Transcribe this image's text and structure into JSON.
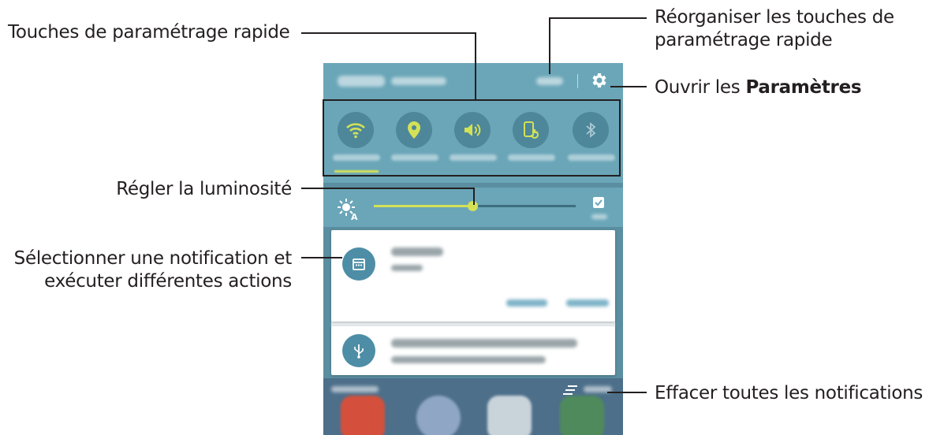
{
  "callouts": {
    "quick_settings": "Touches de paramétrage rapide",
    "rearrange_line1": "Réorganiser les touches de",
    "rearrange_line2": "paramétrage rapide",
    "open_settings_prefix": "Ouvrir les ",
    "open_settings_bold": "Paramètres",
    "brightness": "Régler la luminosité",
    "notification_line1": "Sélectionner une notification et",
    "notification_line2": "exécuter différentes actions",
    "clear_all": "Effacer toutes les notifications"
  },
  "quick_settings": {
    "buttons": [
      {
        "name": "wifi",
        "icon": "wifi-icon",
        "active": true
      },
      {
        "name": "location",
        "icon": "location-pin-icon",
        "active": true
      },
      {
        "name": "sound",
        "icon": "speaker-icon",
        "active": true
      },
      {
        "name": "screen-rotation",
        "icon": "rotation-icon",
        "active": true
      },
      {
        "name": "bluetooth",
        "icon": "bluetooth-icon",
        "active": false
      }
    ]
  },
  "brightness": {
    "level": 0.49
  },
  "colors": {
    "panel": "#6aa6b8",
    "accent": "#d4e157",
    "button_bg": "#4d8799",
    "notification_icon": "#4d8ea6"
  }
}
